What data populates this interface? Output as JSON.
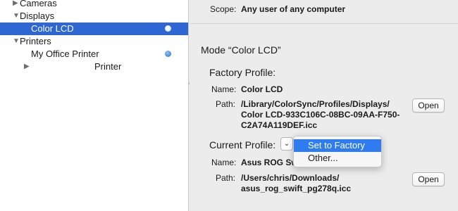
{
  "sidebar": {
    "items": [
      {
        "label": "Cameras",
        "level": 0,
        "expanded": false,
        "selected": false
      },
      {
        "label": "Displays",
        "level": 0,
        "expanded": true,
        "selected": false
      },
      {
        "label": "Color LCD",
        "level": 1,
        "selected": true
      },
      {
        "label": "Printers",
        "level": 0,
        "expanded": true,
        "selected": false
      },
      {
        "label": "My Office Printer",
        "level": 1,
        "selected": false
      },
      {
        "label": "Printer",
        "level": 1,
        "expanded": false,
        "selected": false
      }
    ],
    "colors": {
      "selection": "#2e67d3",
      "status_dot": "#3b86d8"
    }
  },
  "detail": {
    "scope_label": "Scope:",
    "scope_value": "Any user of any computer",
    "mode_title": "Mode “Color LCD”",
    "factory": {
      "heading": "Factory Profile:",
      "name_label": "Name:",
      "name_value": "Color LCD",
      "path_label": "Path:",
      "path_lines": [
        "/Library/ColorSync/Profiles/Displays/",
        "Color LCD-933C106C-08BC-09AA-F750-",
        "C2A74A119DEF.icc"
      ],
      "open_label": "Open"
    },
    "current": {
      "heading": "Current Profile:",
      "name_label": "Name:",
      "name_value": "Asus ROG Sw",
      "path_label": "Path:",
      "path_lines": [
        "/Users/chris/Downloads/",
        "asus_rog_swift_pg278q.icc"
      ],
      "open_label": "Open"
    },
    "popup_menu": {
      "trigger_glyph": "⌄",
      "items": [
        {
          "label": "Set to Factory",
          "highlighted": true
        },
        {
          "label": "Other...",
          "highlighted": false
        }
      ],
      "highlight_color": "#2f7bf0"
    }
  }
}
